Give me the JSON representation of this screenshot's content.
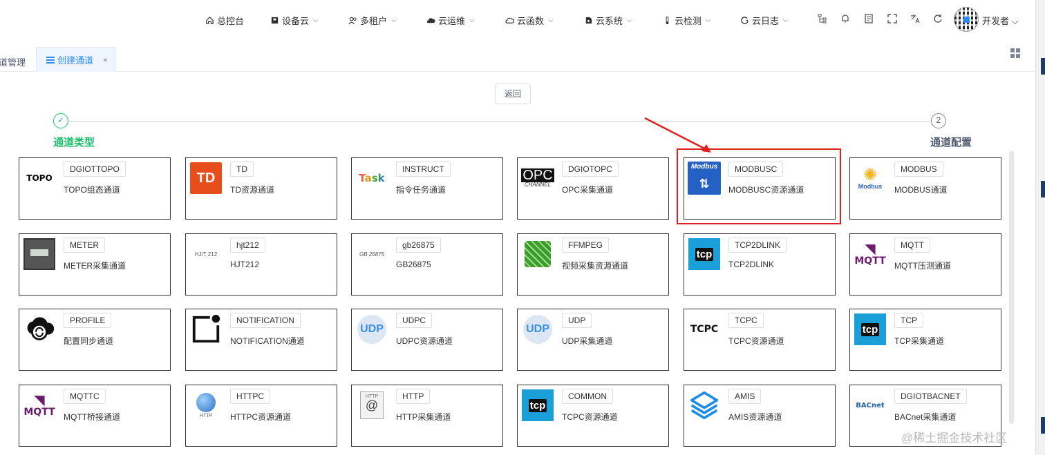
{
  "nav": {
    "items": [
      {
        "label": "总控台",
        "icon": "home-icon",
        "dropdown": false
      },
      {
        "label": "设备云",
        "icon": "device-icon",
        "dropdown": true
      },
      {
        "label": "多租户",
        "icon": "users-icon",
        "dropdown": true
      },
      {
        "label": "云运维",
        "icon": "cloud-icon",
        "dropdown": true
      },
      {
        "label": "云函数",
        "icon": "cloud-function-icon",
        "dropdown": true
      },
      {
        "label": "云系统",
        "icon": "system-icon",
        "dropdown": true
      },
      {
        "label": "云检测",
        "icon": "thermometer-icon",
        "dropdown": true
      },
      {
        "label": "云日志",
        "icon": "log-icon",
        "dropdown": true
      }
    ],
    "tools": [
      "tree-icon",
      "bell-icon",
      "doc-icon",
      "fullscreen-icon",
      "translate-icon",
      "refresh-icon"
    ],
    "user": "开发者"
  },
  "tabs": {
    "previous": "道管理",
    "active": "创建通道",
    "close": "×"
  },
  "back_button": "返回",
  "steps": [
    {
      "number": "✓",
      "title": "通道类型",
      "status": "done"
    },
    {
      "number": "2",
      "title": "通道配置",
      "status": "wait"
    }
  ],
  "cards": [
    {
      "tag": "DGIOTTOPO",
      "desc": "TOPO组态通道",
      "logo_text": "TOPO",
      "logo": "topo"
    },
    {
      "tag": "TD",
      "desc": "TD资源通道",
      "logo_text": "TD",
      "logo": "td"
    },
    {
      "tag": "INSTRUCT",
      "desc": "指令任务通道",
      "logo_text": "Task",
      "logo": "task"
    },
    {
      "tag": "DGIOTOPC",
      "desc": "OPC采集通道",
      "logo_text": "OPC",
      "logo": "opc"
    },
    {
      "tag": "MODBUSC",
      "desc": "MODBUSC资源通道",
      "logo_text": "Modbus",
      "logo": "modbusc"
    },
    {
      "tag": "MODBUS",
      "desc": "MODBUS通道",
      "logo_text": "Modbus",
      "logo": "modbus"
    },
    {
      "tag": "METER",
      "desc": "METER采集通道",
      "logo_text": "",
      "logo": "meter"
    },
    {
      "tag": "hjt212",
      "desc": "HJT212",
      "logo_text": "HJ/T 212",
      "logo": "hjt"
    },
    {
      "tag": "gb26875",
      "desc": "GB26875",
      "logo_text": "GB 26875",
      "logo": "gb"
    },
    {
      "tag": "FFMPEG",
      "desc": "视频采集资源通道",
      "logo_text": "",
      "logo": "ffmpeg"
    },
    {
      "tag": "TCP2DLINK",
      "desc": "TCP2DLINK",
      "logo_text": "tcp",
      "logo": "tcp"
    },
    {
      "tag": "MQTT",
      "desc": "MQTT压测通道",
      "logo_text": "MQTT",
      "logo": "mqtt"
    },
    {
      "tag": "PROFILE",
      "desc": "配置同步通道",
      "logo_text": "",
      "logo": "profile"
    },
    {
      "tag": "NOTIFICATION",
      "desc": "NOTIFICATION通道",
      "logo_text": "",
      "logo": "notification"
    },
    {
      "tag": "UDPC",
      "desc": "UDPC资源通道",
      "logo_text": "UDP",
      "logo": "udp"
    },
    {
      "tag": "UDP",
      "desc": "UDP采集通道",
      "logo_text": "UDP",
      "logo": "udp"
    },
    {
      "tag": "TCPC",
      "desc": "TCPC资源通道",
      "logo_text": "TCPC",
      "logo": "tcpc"
    },
    {
      "tag": "TCP",
      "desc": "TCP采集通道",
      "logo_text": "tcp",
      "logo": "tcp"
    },
    {
      "tag": "MQTTC",
      "desc": "MQTT桥接通道",
      "logo_text": "MQTT",
      "logo": "mqtt"
    },
    {
      "tag": "HTTPC",
      "desc": "HTTPC资源通道",
      "logo_text": "HTTP",
      "logo": "httpc"
    },
    {
      "tag": "HTTP",
      "desc": "HTTP采集通道",
      "logo_text": "HTTP",
      "logo": "http"
    },
    {
      "tag": "COMMON",
      "desc": "TCPC资源通道",
      "logo_text": "tcp",
      "logo": "tcp"
    },
    {
      "tag": "AMIS",
      "desc": "AMIS资源通道",
      "logo_text": "",
      "logo": "amis"
    },
    {
      "tag": "DGIOTBACNET",
      "desc": "BACnet采集通道",
      "logo_text": "BACnet",
      "logo": "bacnet"
    }
  ],
  "annotation": {
    "highlighted_card": "MODBUSC",
    "color": "#e02020"
  },
  "watermark": "@稀土掘金技术社区",
  "colors": {
    "accent": "#2d8cf0",
    "success": "#19be6b",
    "annotation": "#e02020"
  }
}
